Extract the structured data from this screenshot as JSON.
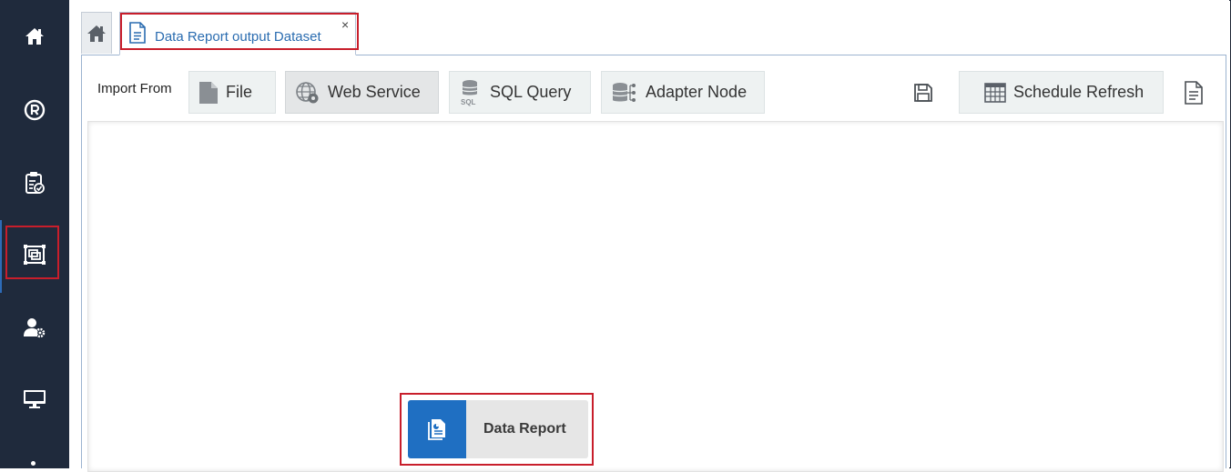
{
  "sidebar": {
    "items": [
      {
        "icon": "home-icon"
      },
      {
        "icon": "registered-icon"
      },
      {
        "icon": "clipboard-check-icon"
      },
      {
        "icon": "object-select-icon",
        "active": true
      },
      {
        "icon": "user-settings-icon"
      },
      {
        "icon": "monitor-icon"
      }
    ]
  },
  "tabs": {
    "home_icon": "home-icon",
    "active_tab": {
      "label": "Data Report output Dataset",
      "icon": "document-icon",
      "close": "×"
    }
  },
  "toolbar": {
    "import_label": "Import From",
    "buttons": {
      "file": "File",
      "web_service": "Web Service",
      "sql_query": "SQL Query",
      "adapter_node": "Adapter Node",
      "schedule_refresh": "Schedule Refresh"
    },
    "sql_icon_caption": "SQL"
  },
  "canvas": {
    "node": {
      "label": "Data Report",
      "icon": "report-icon"
    }
  },
  "colors": {
    "sidebar_bg": "#1f2a3c",
    "accent": "#2a6cb0",
    "node_icon_bg": "#1f6fc2",
    "highlight": "#c81e2b"
  }
}
